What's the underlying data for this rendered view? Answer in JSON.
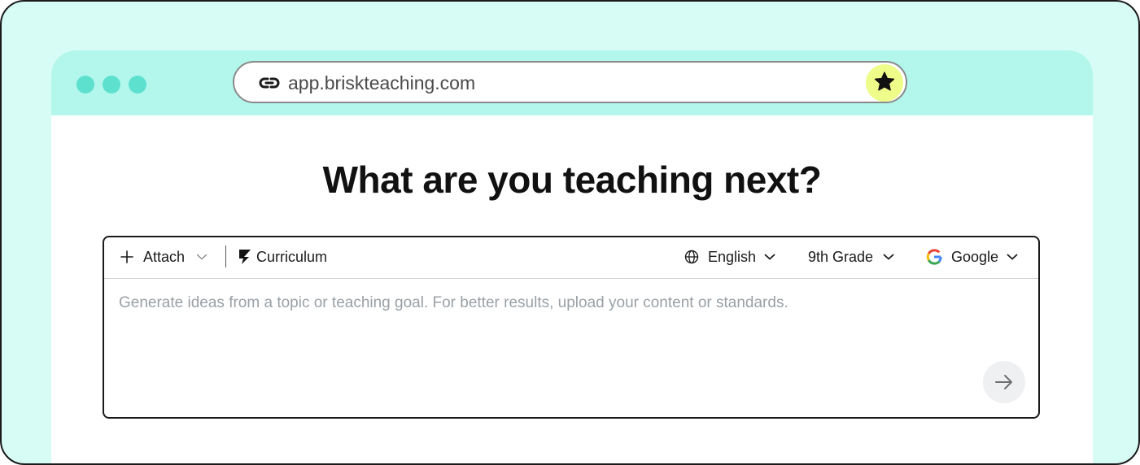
{
  "browser": {
    "url": "app.briskteaching.com",
    "icons": {
      "link": "link-icon",
      "bookmark": "star-icon"
    },
    "colors": {
      "frame_bg": "#d6fcf5",
      "titlebar_bg": "#b3f7ec",
      "traffic_dot": "#5ee0cf",
      "star_button_bg": "#eefc8a"
    }
  },
  "main": {
    "heading": "What are you teaching next?",
    "toolbar": {
      "attach_label": "Attach",
      "curriculum_label": "Curriculum",
      "language_label": "English",
      "grade_label": "9th Grade",
      "integration_label": "Google"
    },
    "prompt": {
      "placeholder": "Generate ideas from a topic or teaching goal. For better results, upload your content or standards.",
      "value": ""
    }
  }
}
